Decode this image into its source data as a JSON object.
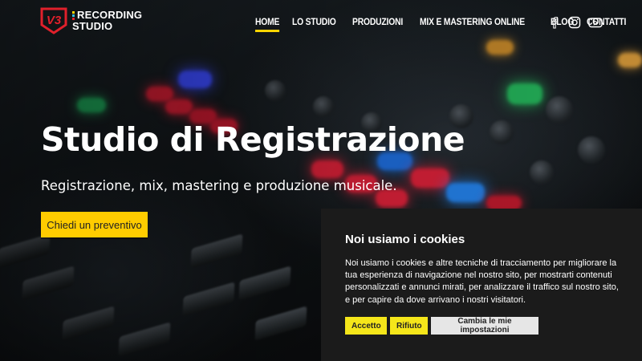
{
  "brand": {
    "logo_mark": "V3",
    "line1": "RECORDING",
    "line2": "STUDIO",
    "accent": "#ffd500",
    "logo_red": "#e0202b"
  },
  "nav": {
    "items": [
      {
        "label": "HOME",
        "active": true
      },
      {
        "label": "LO STUDIO",
        "active": false
      },
      {
        "label": "PRODUZIONI",
        "active": false
      },
      {
        "label": "MIX E MASTERING ONLINE",
        "active": false
      },
      {
        "label": "BLOG",
        "active": false
      },
      {
        "label": "CONTATTI",
        "active": false
      }
    ],
    "social": [
      "facebook-icon",
      "instagram-icon",
      "youtube-icon"
    ]
  },
  "hero": {
    "title": "Studio di Registrazione",
    "subtitle": "Registrazione, mix, mastering e produzione musicale.",
    "cta_label": "Chiedi un preventivo",
    "cta_color": "#ffcc00"
  },
  "cookie": {
    "title": "Noi usiamo i cookies",
    "text": "Noi usiamo i cookies e altre tecniche di tracciamento per migliorare la tua esperienza di navigazione nel nostro sito, per mostrarti contenuti personalizzati e annunci mirati, per analizzare il traffico sul nostro sito, e per capire da dove arrivano i nostri visitatori.",
    "accept_label": "Accetto",
    "reject_label": "Rifiuto",
    "settings_label": "Cambia le mie impostazioni",
    "background": "#1b1b1b",
    "button_yellow": "#f5e61a"
  }
}
